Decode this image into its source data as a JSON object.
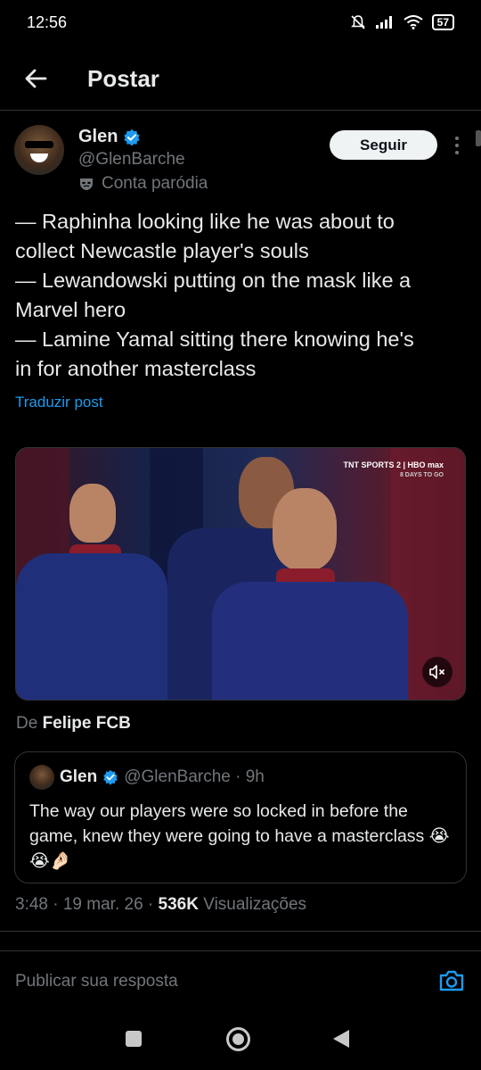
{
  "status_bar": {
    "time": "12:56",
    "battery": "57",
    "icons": [
      "bell-muted-icon",
      "signal-icon",
      "wifi-icon",
      "battery-icon"
    ]
  },
  "header": {
    "title": "Postar",
    "back_icon": "arrow-left-icon"
  },
  "author": {
    "name": "Glen",
    "handle": "@GlenBarche",
    "parody_label": "Conta paródia",
    "verified": true,
    "follow_label": "Seguir"
  },
  "post": {
    "lines": [
      "— Raphinha looking like he was about to",
      "collect Newcastle player's souls",
      "— Lewandowski putting on the mask like a",
      "Marvel hero",
      "— Lamine Yamal sitting there knowing he's",
      "in for another masterclass"
    ],
    "translate_label": "Traduzir post"
  },
  "media": {
    "broadcast_line1": "TNT SPORTS 2 | HBO max",
    "broadcast_line2": "8 DAYS TO GO"
  },
  "source": {
    "prefix": "De",
    "name": "Felipe FCB"
  },
  "quote": {
    "name": "Glen",
    "handle_time": "@GlenBarche · 9h",
    "text": "The way our players were so locked in before the game, knew they were going to have a masterclass 😭😭🤌🏻"
  },
  "meta": {
    "time_date": "3:48 · 19 mar. 26 ·",
    "views_count": "536K",
    "views_label": "Visualizações"
  },
  "reply": {
    "placeholder": "Publicar sua resposta"
  },
  "colors": {
    "background": "#000000",
    "text": "#e7e9ea",
    "muted": "#71767b",
    "accent": "#1d9bf0",
    "divider": "#2f3336"
  }
}
